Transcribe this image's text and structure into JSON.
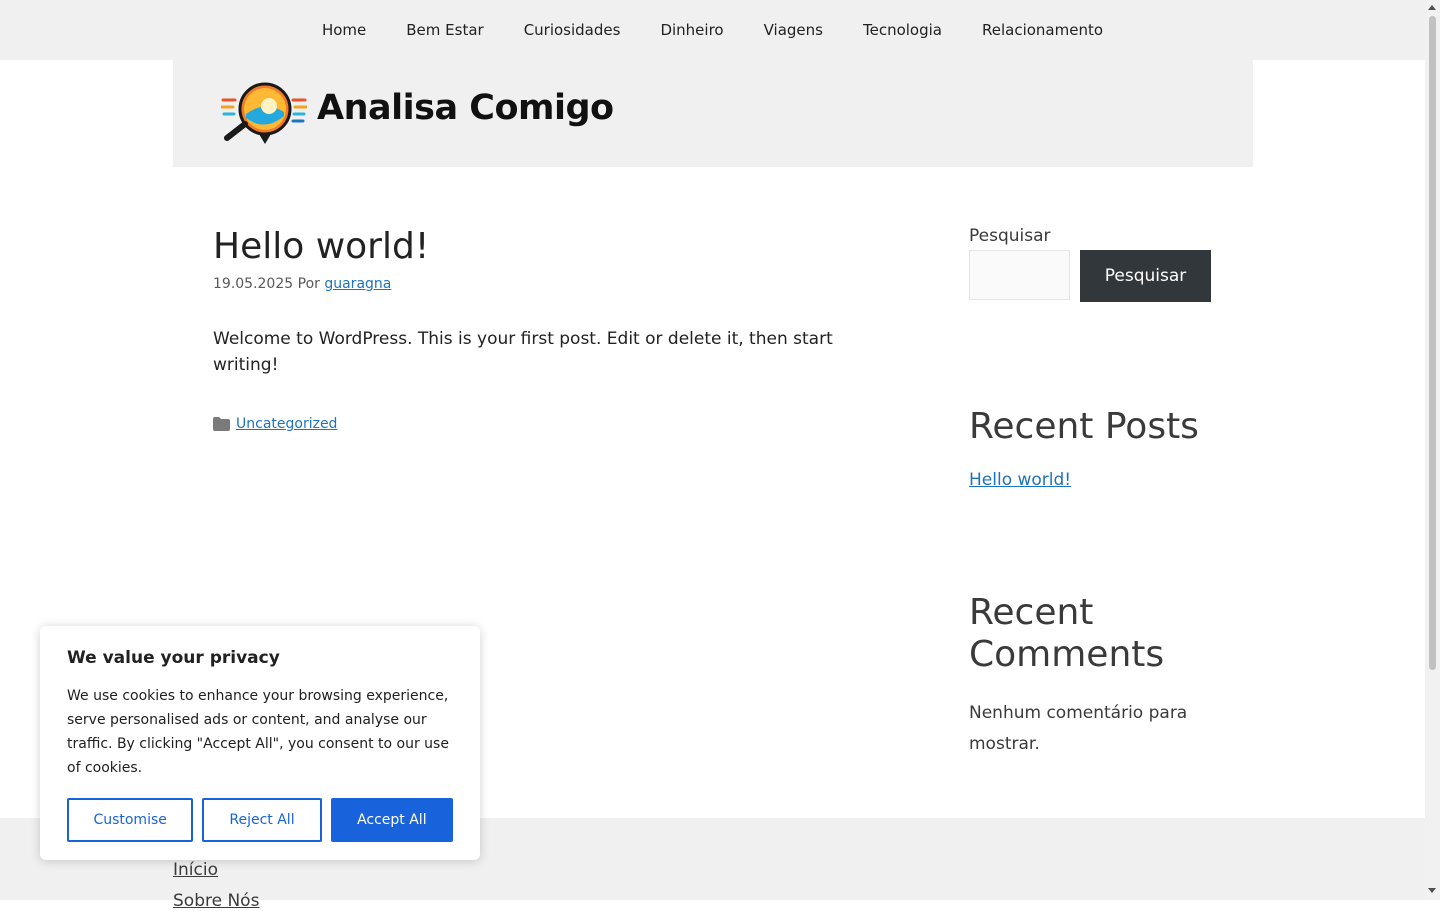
{
  "nav": {
    "items": [
      "Home",
      "Bem Estar",
      "Curiosidades",
      "Dinheiro",
      "Viagens",
      "Tecnologia",
      "Relacionamento"
    ]
  },
  "header": {
    "site_name": "Analisa Comigo",
    "logo_icon": "magnifier-logo-icon"
  },
  "post": {
    "title": "Hello world!",
    "date": "19.05.2025",
    "by": "Por",
    "author": "guaragna",
    "body": "Welcome to WordPress. This is your first post. Edit or delete it, then start writing!",
    "category": "Uncategorized"
  },
  "sidebar": {
    "search_label": "Pesquisar",
    "search_button": "Pesquisar",
    "recent_posts_title": "Recent Posts",
    "recent_posts": [
      "Hello world!"
    ],
    "recent_comments_title": "Recent Comments",
    "recent_comments_empty": "Nenhum comentário para mostrar."
  },
  "footer": {
    "links": [
      "Início",
      "Sobre Nós"
    ]
  },
  "cookie": {
    "title": "We value your privacy",
    "text": "We use cookies to enhance your browsing experience, serve personalised ads or content, and analyse our traffic. By clicking \"Accept All\", you consent to our use of cookies.",
    "customise": "Customise",
    "reject": "Reject All",
    "accept": "Accept All",
    "accent_color": "#1863dc"
  }
}
